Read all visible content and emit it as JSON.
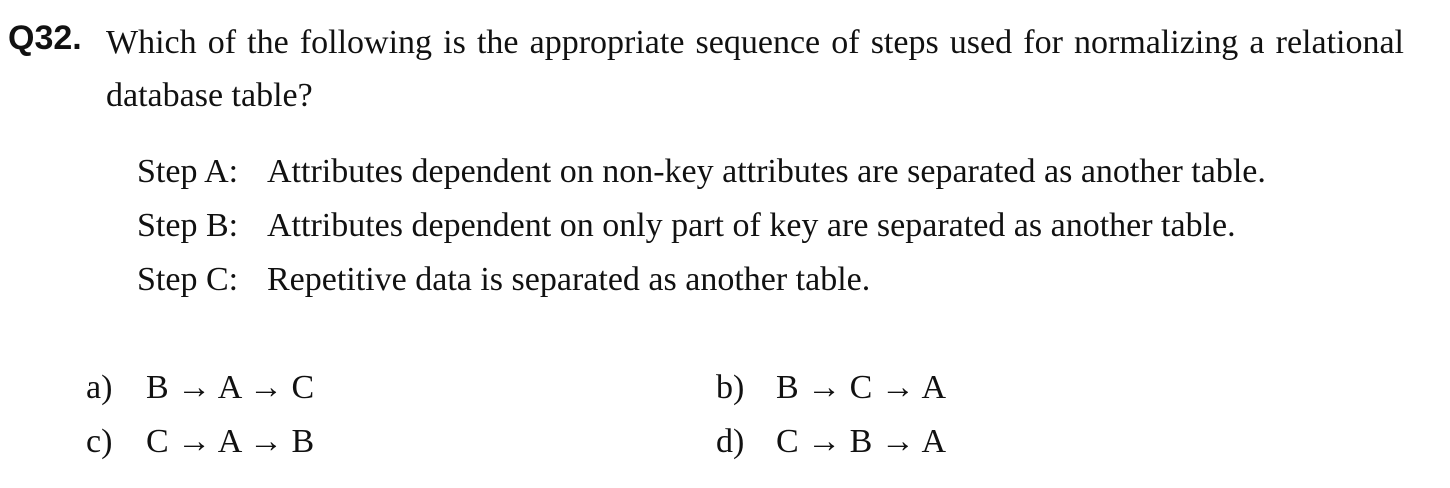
{
  "question": {
    "number": "Q32.",
    "text": "Which of the following is the appropriate sequence of steps used for normalizing a relational database table?"
  },
  "steps": [
    {
      "label": "Step A:",
      "text": "Attributes dependent on non-key attributes are separated as another table."
    },
    {
      "label": "Step B:",
      "text": "Attributes dependent on only part of key are separated as another table."
    },
    {
      "label": "Step C:",
      "text": "Repetitive data is separated as another table."
    }
  ],
  "options": [
    {
      "label": "a)",
      "text": "B → A → C"
    },
    {
      "label": "b)",
      "text": "B → C → A"
    },
    {
      "label": "c)",
      "text": "C → A → B"
    },
    {
      "label": "d)",
      "text": "C → B → A"
    }
  ]
}
